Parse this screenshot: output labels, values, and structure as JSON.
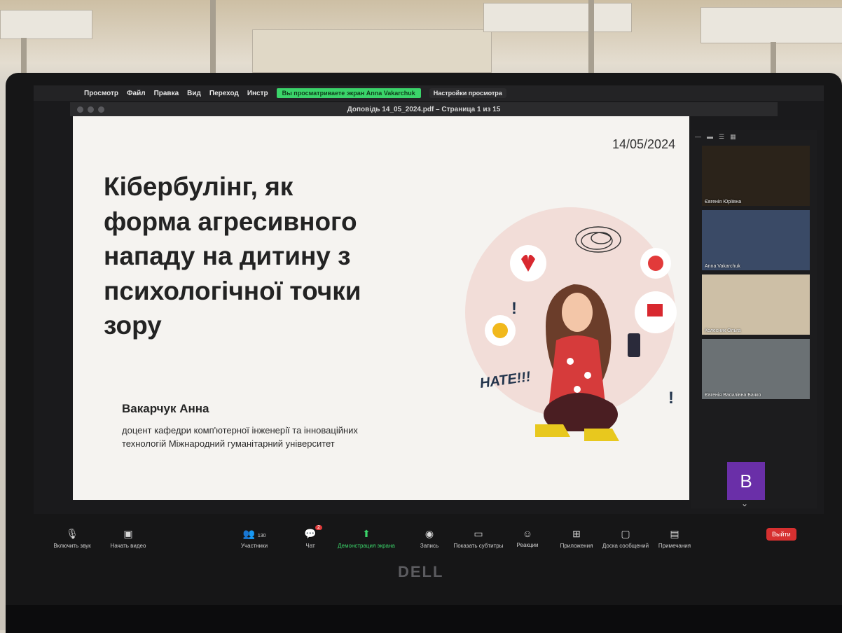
{
  "menu_bar": {
    "items": [
      "Просмотр",
      "Файл",
      "Правка",
      "Вид",
      "Переход",
      "Инстр"
    ],
    "share_banner": "Вы просматриваете экран Anna Vakarchuk",
    "view_options": "Настройки просмотра"
  },
  "viewer": {
    "title": "Доповідь 14_05_2024.pdf – Страница 1 из 15"
  },
  "slide": {
    "date": "14/05/2024",
    "title_lines": [
      "Кібербулінг,  як",
      "форма агресивного",
      "нападу на дитину з",
      "психологічної точки",
      "зору"
    ],
    "author": "Вакарчук Анна",
    "affiliation_lines": [
      "доцент кафедри комп'ютерної інженерії та інноваційних",
      "технологій Міжнародний гуманітарний університет"
    ],
    "illustration_text": "HATE!!!"
  },
  "participants": {
    "tiles": [
      {
        "name": "Євгенія Юріївна",
        "bg": "#2b231a"
      },
      {
        "name": "Anna Vakarchuk",
        "bg": "#3a4a66"
      },
      {
        "name": "Колесник Ольга",
        "bg": "#cdbfa6"
      },
      {
        "name": "Євгенія Василівна Бачко",
        "bg": "#6b7174"
      }
    ],
    "avatar_letter": "B",
    "avatar_color": "#6a2fa8"
  },
  "controls": {
    "items": [
      {
        "label": "Включить звук",
        "icon": "mic-off-icon"
      },
      {
        "label": "Начать видео",
        "icon": "video-off-icon"
      },
      {
        "label": "Участники",
        "icon": "participants-icon",
        "count": "130"
      },
      {
        "label": "Чат",
        "icon": "chat-icon",
        "badge": "2"
      },
      {
        "label": "Демонстрация экрана",
        "icon": "share-screen-icon"
      },
      {
        "label": "Запись",
        "icon": "record-icon"
      },
      {
        "label": "Показать субтитры",
        "icon": "captions-icon"
      },
      {
        "label": "Реакции",
        "icon": "reactions-icon"
      },
      {
        "label": "Приложения",
        "icon": "apps-icon"
      },
      {
        "label": "Доска сообщений",
        "icon": "whiteboard-icon"
      },
      {
        "label": "Примечания",
        "icon": "notes-icon"
      }
    ],
    "leave": "Выйти"
  },
  "brand": "DELL",
  "accent_green": "#3bd46a",
  "leave_red": "#d63030"
}
